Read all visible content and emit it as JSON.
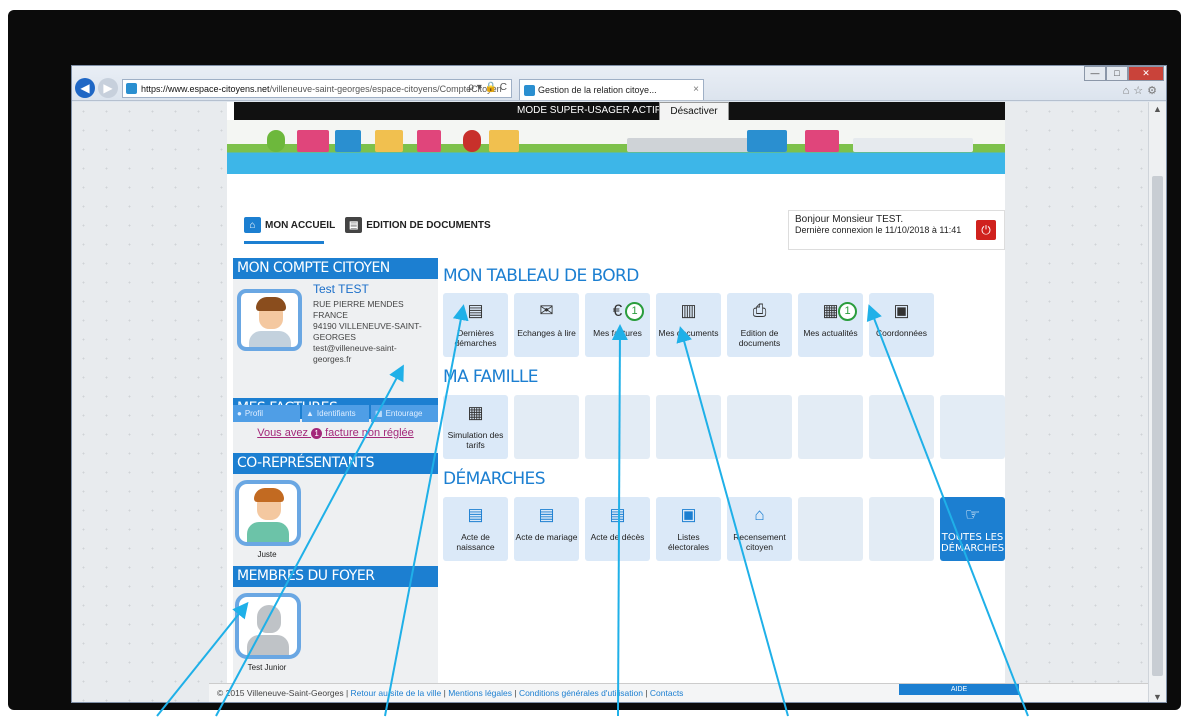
{
  "browser": {
    "url_host": "https://www.espace-citoyens.net",
    "url_path": "/villeneuve-saint-georges/espace-citoyens/CompteCitoyen",
    "addr_tools": "ρ ▾ 🔒 C",
    "tab_title": "Gestion de la relation citoye...",
    "tab_close": "×",
    "win_min": "—",
    "win_max": "□",
    "win_close": "✕"
  },
  "super_user": {
    "label": "MODE SUPER-USAGER ACTIF",
    "deactivate": "Désactiver"
  },
  "nav": {
    "home": "MON ACCUEIL",
    "documents": "EDITION DE DOCUMENTS"
  },
  "welcome": {
    "greeting": "Bonjour Monsieur TEST.",
    "last_login": "Dernière connexion le 11/10/2018 à 11:41"
  },
  "account": {
    "title": "MON COMPTE CITOYEN",
    "name": "Test TEST",
    "address1": "RUE PIERRE MENDES FRANCE",
    "address2": "94190 VILLENEUVE-SAINT-GEORGES",
    "email": "test@villeneuve-saint-georges.fr",
    "tabs": [
      "Profil",
      "Identifiants",
      "Entourage"
    ]
  },
  "invoices": {
    "title": "MES FACTURES",
    "prefix": "Vous avez",
    "count": "1",
    "suffix": "facture non réglée"
  },
  "co_reps": {
    "title": "CO-REPRÉSENTANTS",
    "members": [
      "Juste"
    ]
  },
  "household": {
    "title": "MEMBRES DU FOYER",
    "members": [
      "Test Junior"
    ]
  },
  "dashboard": {
    "title": "MON TABLEAU DE BORD",
    "tiles": [
      {
        "label": "Dernières démarches",
        "icon": "list-icon"
      },
      {
        "label": "Echanges à lire",
        "icon": "envelope-icon"
      },
      {
        "label": "Mes factures",
        "icon": "euro-invoice-icon",
        "badge": "1"
      },
      {
        "label": "Mes documents",
        "icon": "document-drawer-icon"
      },
      {
        "label": "Edition de documents",
        "icon": "printer-icon"
      },
      {
        "label": "Mes actualités",
        "icon": "newspaper-icon",
        "badge": "1"
      },
      {
        "label": "Coordonnées",
        "icon": "contact-card-icon"
      }
    ]
  },
  "family": {
    "title": "MA FAMILLE",
    "tiles": [
      {
        "label": "Simulation des tarifs",
        "icon": "calculator-icon"
      }
    ]
  },
  "procedures": {
    "title": "DÉMARCHES",
    "tiles": [
      {
        "label": "Acte de naissance",
        "icon": "certificate-icon"
      },
      {
        "label": "Acte de mariage",
        "icon": "certificate-icon"
      },
      {
        "label": "Acte de décès",
        "icon": "certificate-icon"
      },
      {
        "label": "Listes électorales",
        "icon": "ballot-box-icon"
      },
      {
        "label": "Recensement citoyen",
        "icon": "house-people-icon"
      }
    ],
    "all_label": "TOUTES LES DÉMARCHES"
  },
  "footer": {
    "copyright": "© 2015 Villeneuve-Saint-Georges |",
    "links": [
      "Retour au site de la ville",
      "Mentions légales",
      "Conditions générales d'utilisation",
      "Contacts"
    ],
    "help": "AIDE"
  }
}
